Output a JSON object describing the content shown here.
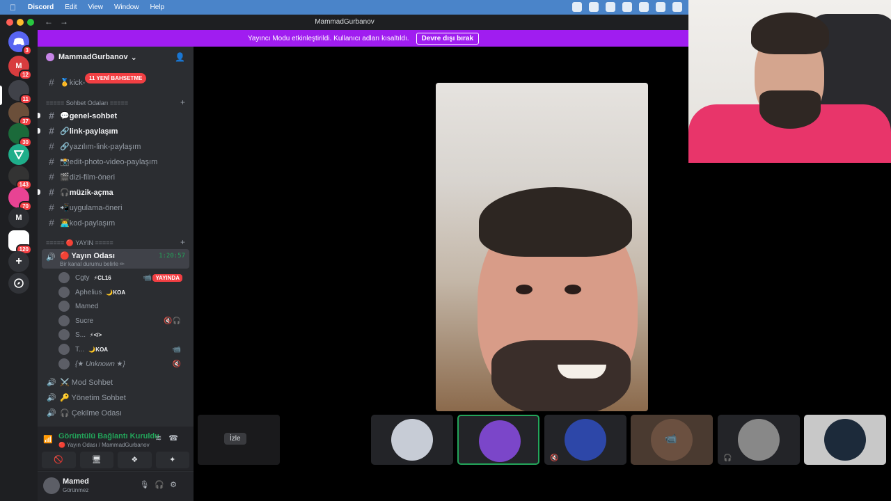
{
  "menubar": {
    "app": "Discord",
    "items": [
      "Edit",
      "View",
      "Window",
      "Help"
    ]
  },
  "window": {
    "title": "MammadGurbanov"
  },
  "banner": {
    "text": "Yayıncı Modu etkinleştirildi. Kullanıcı adları kısaltıldı.",
    "button": "Devre dışı bırak"
  },
  "servers": [
    {
      "label": "",
      "badge": "3",
      "color": "#5865f2"
    },
    {
      "label": "M",
      "badge": "12",
      "color": "#d83c3e"
    },
    {
      "label": "",
      "badge": "11",
      "color": "#404249"
    },
    {
      "label": "",
      "badge": "37",
      "color": "#6b4f3a"
    },
    {
      "label": "",
      "badge": "30",
      "color": "#1b6a3a"
    },
    {
      "label": "",
      "badge": "",
      "color": "#1fae8a"
    },
    {
      "label": "",
      "badge": "143",
      "color": "#333"
    },
    {
      "label": "",
      "badge": "70",
      "color": "#e84393"
    },
    {
      "label": "M",
      "badge": "",
      "color": "#2b2d31"
    },
    {
      "label": "",
      "badge": "120",
      "color": "#ffffff"
    }
  ],
  "sidebar": {
    "guild_name": "MammadGurbanov",
    "mention_pill": "11 YENİ BAHSETME",
    "top_channel": "🥇kick-",
    "categories": {
      "chat": "===== Sohbet Odaları =====",
      "stream": "===== 🔴 YAYIN ====="
    },
    "channels": [
      {
        "label": "💬genel-sohbet",
        "unread": true
      },
      {
        "label": "🔗link-paylaşım",
        "unread": true
      },
      {
        "label": "🔗yazılım-link-paylaşım",
        "unread": false
      },
      {
        "label": "📸edit-photo-video-paylaşım",
        "unread": false
      },
      {
        "label": "🎬dizi-film-öneri",
        "unread": false
      },
      {
        "label": "🎧müzik-açma",
        "unread": true
      },
      {
        "label": "📲uygulama-öneri",
        "unread": false
      },
      {
        "label": "👨‍💻kod-paylaşım",
        "unread": false
      }
    ],
    "active_voice": {
      "name": "🔴 Yayın Odası",
      "status": "Bir kanal durumu belirle ✏",
      "time": "1:20:57"
    },
    "voice_users": [
      {
        "name": "Cgty",
        "tag": "⚡CL16",
        "live": "YAYINDA",
        "icon": ""
      },
      {
        "name": "Aphelius",
        "tag": "🌙KOA",
        "live": "",
        "icon": ""
      },
      {
        "name": "Mamed",
        "tag": "",
        "live": "",
        "icon": ""
      },
      {
        "name": "Sucre",
        "tag": "",
        "live": "",
        "icon": "🔇🎧"
      },
      {
        "name": "S...",
        "tag": "⚡</>",
        "live": "",
        "icon": ""
      },
      {
        "name": "T...",
        "tag": "🌙KOA",
        "live": "",
        "icon": "📹"
      },
      {
        "name": "{★ Unknown ★}",
        "tag": "",
        "live": "",
        "icon": "🔇"
      }
    ],
    "voice_channels": [
      {
        "label": "⚔️ Mod Sohbet"
      },
      {
        "label": "🔑 Yönetim Sohbet"
      },
      {
        "label": "🎧 Çekilme Odası"
      }
    ],
    "voice_panel": {
      "title": "Görüntülü Bağlantı Kuruldu",
      "subtitle": "🔴 Yayın Odası / MammadGurbanov"
    },
    "user": {
      "name": "Mamed",
      "status": "Görünmez"
    }
  },
  "stage": {
    "watch_label": "İzle"
  },
  "colors": {
    "accent": "#5865f2",
    "banner": "#a01df0",
    "green": "#23a55a",
    "red": "#f23f43"
  }
}
